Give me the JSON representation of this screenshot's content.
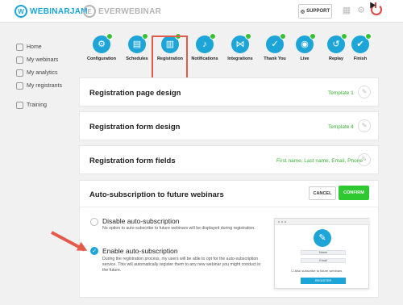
{
  "header": {
    "logo_main": "WEBINARJAM",
    "logo_secondary": "EVERWEBINAR",
    "support_label": "SUPPORT"
  },
  "sidebar": {
    "items": [
      {
        "label": "Home",
        "icon": "home-icon"
      },
      {
        "label": "My webinars",
        "icon": "monitor-icon"
      },
      {
        "label": "My analytics",
        "icon": "analytics-icon"
      },
      {
        "label": "My registrants",
        "icon": "registrants-icon"
      },
      {
        "label": "Training",
        "icon": "training-icon"
      }
    ]
  },
  "steps": [
    {
      "label": "Configuration",
      "icon": "gear-icon",
      "completed": true
    },
    {
      "label": "Schedules",
      "icon": "calendar-icon",
      "completed": true
    },
    {
      "label": "Registration",
      "icon": "registration-icon",
      "completed": true,
      "active": true
    },
    {
      "label": "Notifications",
      "icon": "bell-icon",
      "completed": true
    },
    {
      "label": "Integrations",
      "icon": "share-icon",
      "completed": true
    },
    {
      "label": "Thank You",
      "icon": "thumbs-up-icon",
      "completed": true
    },
    {
      "label": "Live",
      "icon": "broadcast-icon",
      "completed": true
    },
    {
      "label": "Replay",
      "icon": "replay-icon",
      "completed": true
    },
    {
      "label": "Finish",
      "icon": "finish-icon",
      "completed": true
    }
  ],
  "sections": {
    "page_design": {
      "title": "Registration page design",
      "value": "Template 1"
    },
    "form_design": {
      "title": "Registration form design",
      "value": "Template 4"
    },
    "form_fields": {
      "title": "Registration form fields",
      "value": "First name, Last name, Email, Phone"
    }
  },
  "auto_subscription": {
    "title": "Auto-subscription to future webinars",
    "cancel_label": "CANCEL",
    "confirm_label": "CONFIRM",
    "options": [
      {
        "title": "Disable auto-subscription",
        "description": "No option to auto-subscribe to future webinars will be displayed during registration.",
        "selected": false
      },
      {
        "title": "Enable auto-subscription",
        "description": "During the registration process, my users will be able to opt for the auto-subscription service. This will automatically register them to any new webinar you might conduct in the future.",
        "selected": true
      }
    ],
    "preview": {
      "name_placeholder": "Name",
      "email_placeholder": "Email",
      "checkbox_label": "Also subscribe to future webinars",
      "register_label": "REGISTER"
    }
  },
  "colors": {
    "accent": "#1ea5d8",
    "success": "#35b731",
    "highlight": "#e05b4d"
  }
}
